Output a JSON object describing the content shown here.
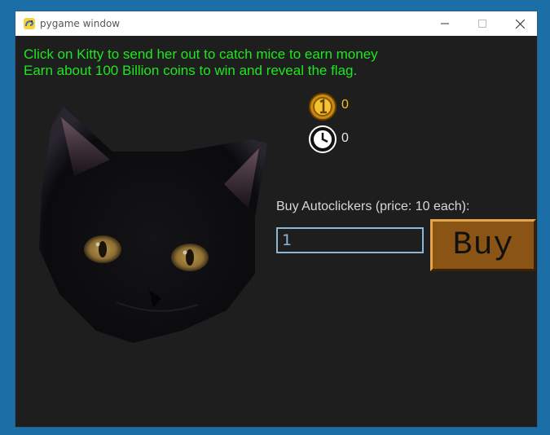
{
  "window": {
    "title": "pygame window",
    "buttons": {
      "minimize": "minimize",
      "maximize": "maximize",
      "close": "close"
    }
  },
  "instructions": {
    "line1": "Click on Kitty to send her out to catch mice to earn money",
    "line2": "Earn about 100 Billion coins to win and reveal the flag."
  },
  "stats": {
    "coins": "0",
    "time": "0"
  },
  "shop": {
    "label": "Buy Autoclickers (price: 10 each):",
    "quantity_value": "1",
    "buy_label": "Buy"
  },
  "icons": {
    "app": "pygame-snake-icon",
    "coin": "coin-icon",
    "clock": "clock-icon",
    "cat": "black-cat-face"
  },
  "colors": {
    "instructions": "#1fe61f",
    "coins": "#f4c21d",
    "background": "#1e1e1e",
    "buy_button": "#8a5414",
    "input_border": "#8bb6d6"
  }
}
